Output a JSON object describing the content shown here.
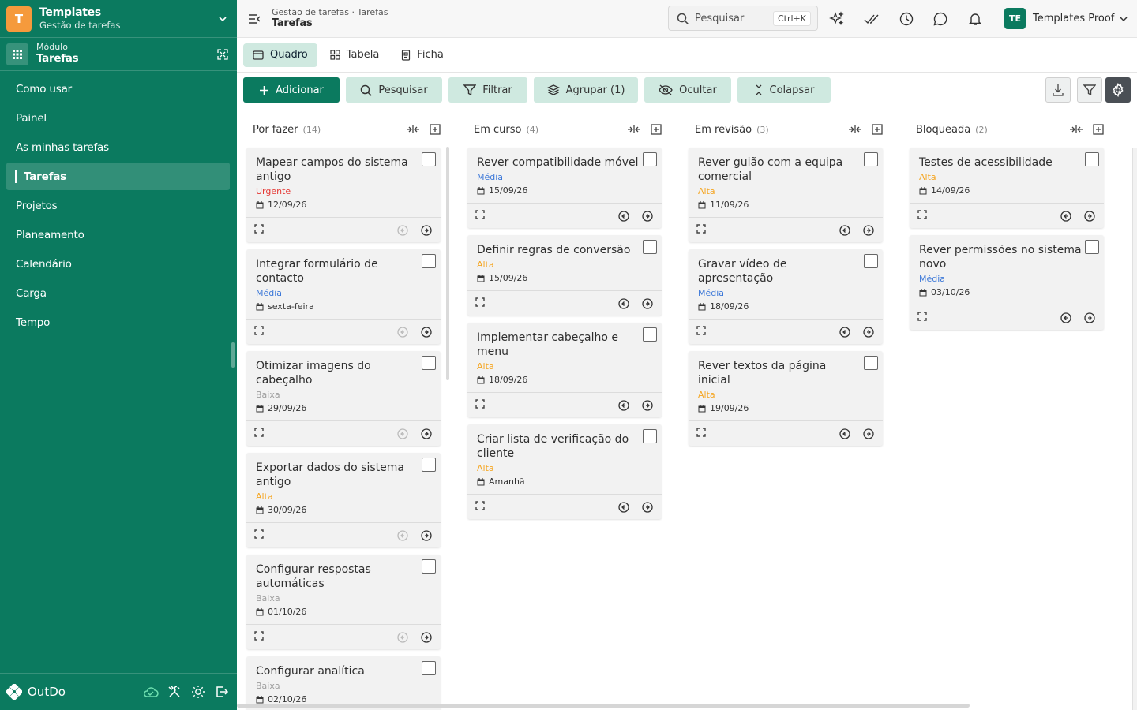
{
  "workspace": {
    "initial": "T",
    "name": "Templates",
    "subtitle": "Gestão de tarefas"
  },
  "module": {
    "label": "Módulo",
    "name": "Tarefas"
  },
  "nav": [
    {
      "label": "Como usar"
    },
    {
      "label": "Painel"
    },
    {
      "label": "As minhas tarefas"
    },
    {
      "label": "Tarefas",
      "active": true
    },
    {
      "label": "Projetos"
    },
    {
      "label": "Planeamento"
    },
    {
      "label": "Calendário"
    },
    {
      "label": "Carga"
    },
    {
      "label": "Tempo"
    }
  ],
  "footer": {
    "brand": "OutDo"
  },
  "topbar": {
    "breadcrumb": "Gestão de tarefas · Tarefas",
    "title": "Tarefas",
    "search_placeholder": "Pesquisar",
    "search_shortcut": "Ctrl+K",
    "user_initials": "TE",
    "user_name": "Templates Proof"
  },
  "views": [
    {
      "label": "Quadro",
      "icon": "board-icon",
      "active": true
    },
    {
      "label": "Tabela",
      "icon": "table-icon"
    },
    {
      "label": "Ficha",
      "icon": "form-icon"
    }
  ],
  "actions": {
    "add": "Adicionar",
    "search": "Pesquisar",
    "filter": "Filtrar",
    "group": "Agrupar (1)",
    "hide": "Ocultar",
    "collapse": "Colapsar"
  },
  "colors": {
    "brand": "#0b7a5f",
    "accent_light": "#cfe9e0",
    "priority_urgente": "#e53935",
    "priority_alta": "#f5a623",
    "priority_media": "#3c78d8",
    "priority_baixa": "#9e9e9e"
  },
  "columns": [
    {
      "title": "Por fazer",
      "count": "(14)",
      "cards": [
        {
          "title": "Mapear campos do sistema antigo",
          "priority": "Urgente",
          "date": "12/09/26"
        },
        {
          "title": "Integrar formulário de contacto",
          "priority": "Média",
          "date": "sexta-feira"
        },
        {
          "title": "Otimizar imagens do cabeçalho",
          "priority": "Baixa",
          "date": "29/09/26"
        },
        {
          "title": "Exportar dados do sistema antigo",
          "priority": "Alta",
          "date": "30/09/26"
        },
        {
          "title": "Configurar respostas automáticas",
          "priority": "Baixa",
          "date": "01/10/26"
        },
        {
          "title": "Configurar analítica",
          "priority": "Baixa",
          "date": "02/10/26"
        }
      ]
    },
    {
      "title": "Em curso",
      "count": "(4)",
      "cards": [
        {
          "title": "Rever compatibilidade móvel",
          "priority": "Média",
          "date": "15/09/26"
        },
        {
          "title": "Definir regras de conversão",
          "priority": "Alta",
          "date": "15/09/26"
        },
        {
          "title": "Implementar cabeçalho e menu",
          "priority": "Alta",
          "date": "18/09/26"
        },
        {
          "title": "Criar lista de verificação do cliente",
          "priority": "Alta",
          "date": "Amanhã"
        }
      ]
    },
    {
      "title": "Em revisão",
      "count": "(3)",
      "cards": [
        {
          "title": "Rever guião com a equipa comercial",
          "priority": "Alta",
          "date": "11/09/26"
        },
        {
          "title": "Gravar vídeo de apresentação",
          "priority": "Média",
          "date": "18/09/26"
        },
        {
          "title": "Rever textos da página inicial",
          "priority": "Alta",
          "date": "19/09/26"
        }
      ]
    },
    {
      "title": "Bloqueada",
      "count": "(2)",
      "cards": [
        {
          "title": "Testes de acessibilidade",
          "priority": "Alta",
          "date": "14/09/26"
        },
        {
          "title": "Rever permissões no sistema novo",
          "priority": "Média",
          "date": "03/10/26"
        }
      ]
    }
  ]
}
